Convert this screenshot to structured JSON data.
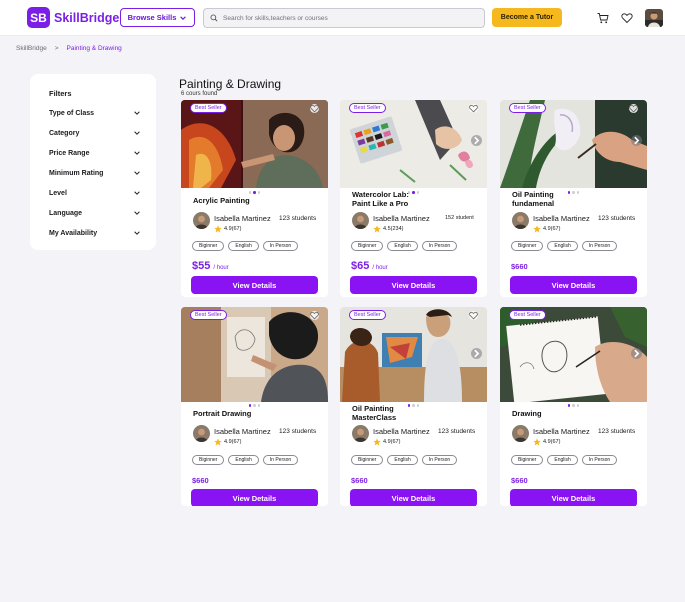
{
  "brand": {
    "mark": "SB",
    "name": "SkillBridge"
  },
  "header": {
    "browse_label": "Browse Skills",
    "search_placeholder": "Search for skills,teachers or courses",
    "tutor_label": "Become a Tutor"
  },
  "breadcrumb": {
    "root": "SkillBridge",
    "separator": ">",
    "current": "Painting & Drawing"
  },
  "filters": {
    "title": "Filters",
    "items": [
      "Type of Class",
      "Category",
      "Price Range",
      "Minimum Rating",
      "Level",
      "Language",
      "My Availability"
    ]
  },
  "page": {
    "title": "Painting & Drawing",
    "count": "6 cours found"
  },
  "cta_label": "View Details",
  "cards": [
    {
      "badge": "Best Seller",
      "title": "Acrylic Painting",
      "tutor": "Isabella Martinez",
      "students": "123 students",
      "rating": "4.9(67)",
      "tags": [
        "Biginner",
        "English",
        "In Person"
      ],
      "price": "$55",
      "per": "/ hour"
    },
    {
      "badge": "Best Seller",
      "title": "Watercolor Lab: Paint Like a Pro",
      "tutor": "Isabella Martinez",
      "students": "152 student",
      "rating": "4.5(234)",
      "tags": [
        "Biginner",
        "English",
        "In Person"
      ],
      "price": "$65",
      "per": "/ hour"
    },
    {
      "badge": "Best Seller",
      "title": "Oil Painting fundamenal",
      "tutor": "Isabella Martinez",
      "students": "123 students",
      "rating": "4.9(67)",
      "tags": [
        "Biginner",
        "English",
        "In Person"
      ],
      "price": "$660",
      "per": ""
    },
    {
      "badge": "Best Seller",
      "title": "Portrait Drawing",
      "tutor": "Isabella Martinez",
      "students": "123 students",
      "rating": "4.9(67)",
      "tags": [
        "Biginner",
        "English",
        "In Person"
      ],
      "price": "$660",
      "per": ""
    },
    {
      "badge": "Best Seller",
      "title": "Oil Painting MasterClass",
      "tutor": "Isabella Martinez",
      "students": "123 students",
      "rating": "4.9(67)",
      "tags": [
        "Biginner",
        "English",
        "In Person"
      ],
      "price": "$660",
      "per": ""
    },
    {
      "badge": "Best Seller",
      "title": "Drawing",
      "tutor": "Isabella Martinez",
      "students": "123 students",
      "rating": "4.9(67)",
      "tags": [
        "Biginner",
        "English",
        "In Person"
      ],
      "price": "$660",
      "per": ""
    }
  ],
  "colors": {
    "accent": "#7b1fe6",
    "cta": "#8a13f4",
    "tutor_button": "#f5b81f",
    "star": "#f5b81f"
  }
}
